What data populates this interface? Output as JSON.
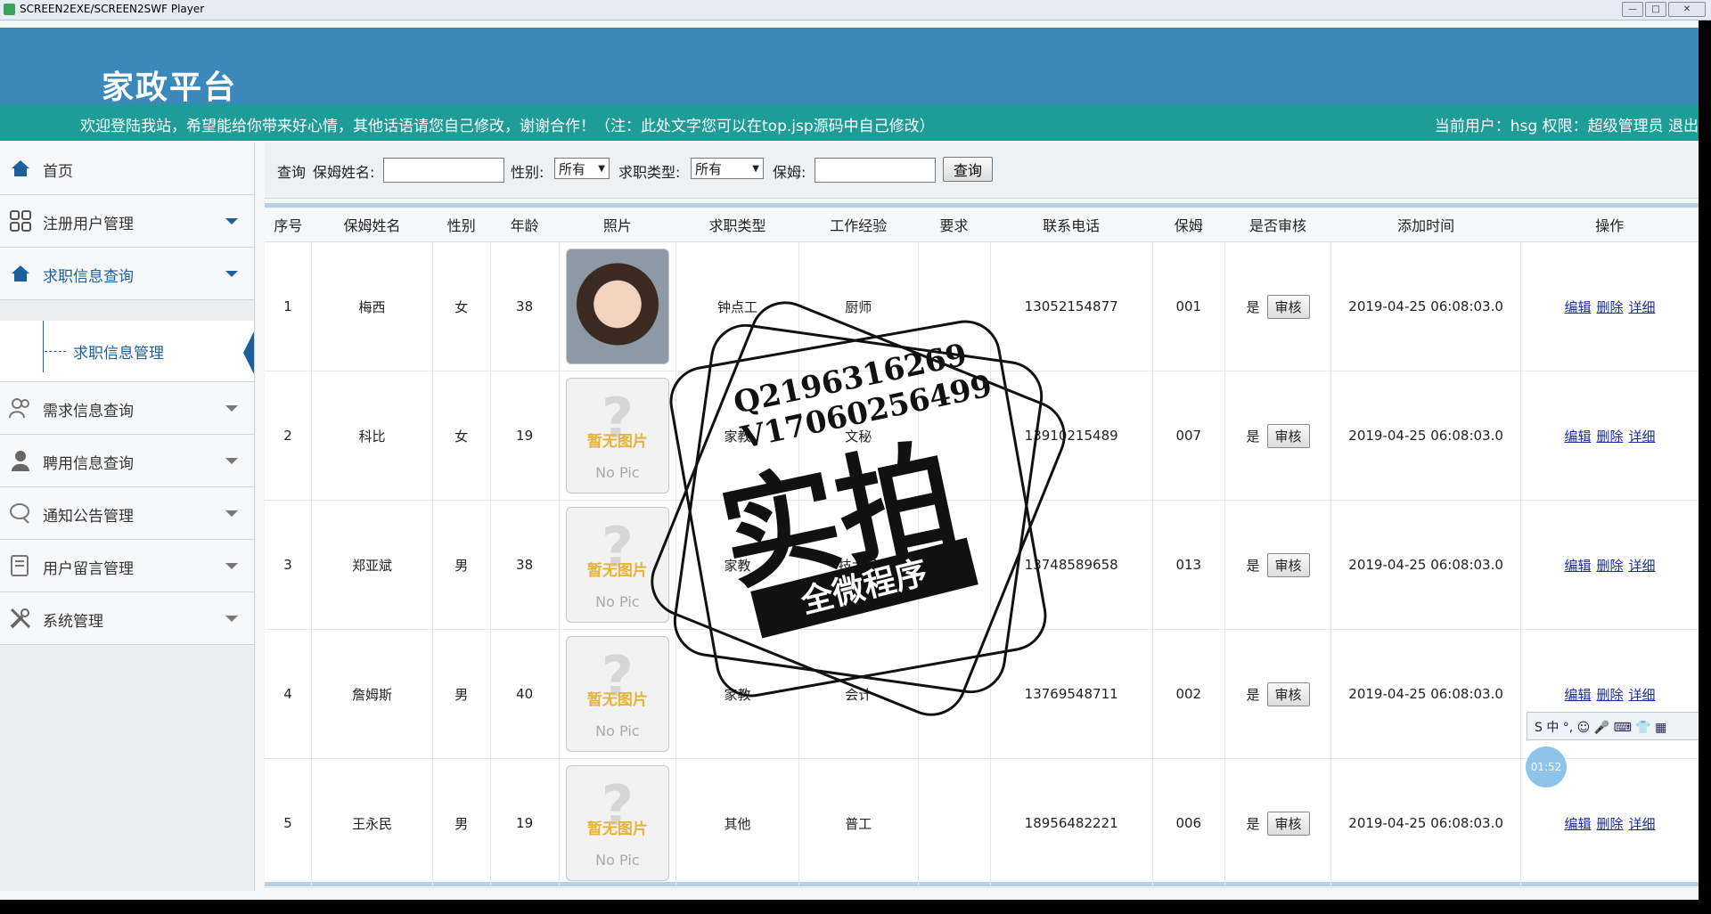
{
  "window": {
    "title": "SCREEN2EXE/SCREEN2SWF Player",
    "buttons": [
      "—",
      "□",
      "✕"
    ]
  },
  "header": {
    "site_title": "家政平台",
    "welcome": "欢迎登陆我站，希望能给你带来好心情，其他话语请您自己修改，谢谢合作！（注：此处文字您可以在top.jsp源码中自己修改）",
    "user_info": "当前用户：hsg 权限：超级管理员 退出"
  },
  "sidebar": {
    "items": [
      {
        "label": "首页",
        "icon": "home-icon"
      },
      {
        "label": "注册用户管理",
        "icon": "grid-icon"
      },
      {
        "label": "求职信息查询",
        "icon": "home-icon"
      },
      {
        "label": "需求信息查询",
        "icon": "users-icon"
      },
      {
        "label": "聘用信息查询",
        "icon": "user-icon"
      },
      {
        "label": "通知公告管理",
        "icon": "chat-icon"
      },
      {
        "label": "用户留言管理",
        "icon": "note-icon"
      },
      {
        "label": "系统管理",
        "icon": "tools-icon"
      }
    ],
    "sub_item": "求职信息管理"
  },
  "search": {
    "prefix": "查询",
    "name_label": "保姆姓名:",
    "gender_label": "性别:",
    "gender_value": "所有",
    "type_label": "求职类型:",
    "type_value": "所有",
    "nanny_label": "保姆:",
    "button": "查询"
  },
  "table": {
    "headers": [
      "序号",
      "保姆姓名",
      "性别",
      "年龄",
      "照片",
      "求职类型",
      "工作经验",
      "要求",
      "联系电话",
      "保姆",
      "是否审核",
      "添加时间",
      "操作"
    ],
    "rows": [
      {
        "no": "1",
        "name": "梅西",
        "gender": "女",
        "age": "38",
        "photo": "real",
        "type": "钟点工",
        "exp": "厨师",
        "req": "",
        "phone": "13052154877",
        "nanny": "001",
        "audited": "是",
        "time": "2019-04-25 06:08:03.0"
      },
      {
        "no": "2",
        "name": "科比",
        "gender": "女",
        "age": "19",
        "photo": "none",
        "type": "家教",
        "exp": "文秘",
        "req": "",
        "phone": "13910215489",
        "nanny": "007",
        "audited": "是",
        "time": "2019-04-25 06:08:03.0"
      },
      {
        "no": "3",
        "name": "郑亚斌",
        "gender": "男",
        "age": "38",
        "photo": "none",
        "type": "家教",
        "exp": "技术员",
        "req": "",
        "phone": "13748589658",
        "nanny": "013",
        "audited": "是",
        "time": "2019-04-25 06:08:03.0"
      },
      {
        "no": "4",
        "name": "詹姆斯",
        "gender": "男",
        "age": "40",
        "photo": "none",
        "type": "家教",
        "exp": "会计",
        "req": "",
        "phone": "13769548711",
        "nanny": "002",
        "audited": "是",
        "time": "2019-04-25 06:08:03.0"
      },
      {
        "no": "5",
        "name": "王永民",
        "gender": "男",
        "age": "19",
        "photo": "none",
        "type": "其他",
        "exp": "普工",
        "req": "",
        "phone": "18956482221",
        "nanny": "006",
        "audited": "是",
        "time": "2019-04-25 06:08:03.0"
      }
    ],
    "audit_button": "审核",
    "no_pic": {
      "q": "?",
      "zh": "暂无图片",
      "en": "No Pic"
    },
    "ops": [
      "编辑",
      "删除",
      "详细"
    ]
  },
  "stamp": {
    "line1": "Q2196316269",
    "line2": "V17060256499",
    "big": "实拍",
    "ribbon": "全微程序"
  },
  "ime": {
    "text": "S 中 °, ☺ 🎤 ⌨ 👕 ▦"
  },
  "timer": "01:52"
}
